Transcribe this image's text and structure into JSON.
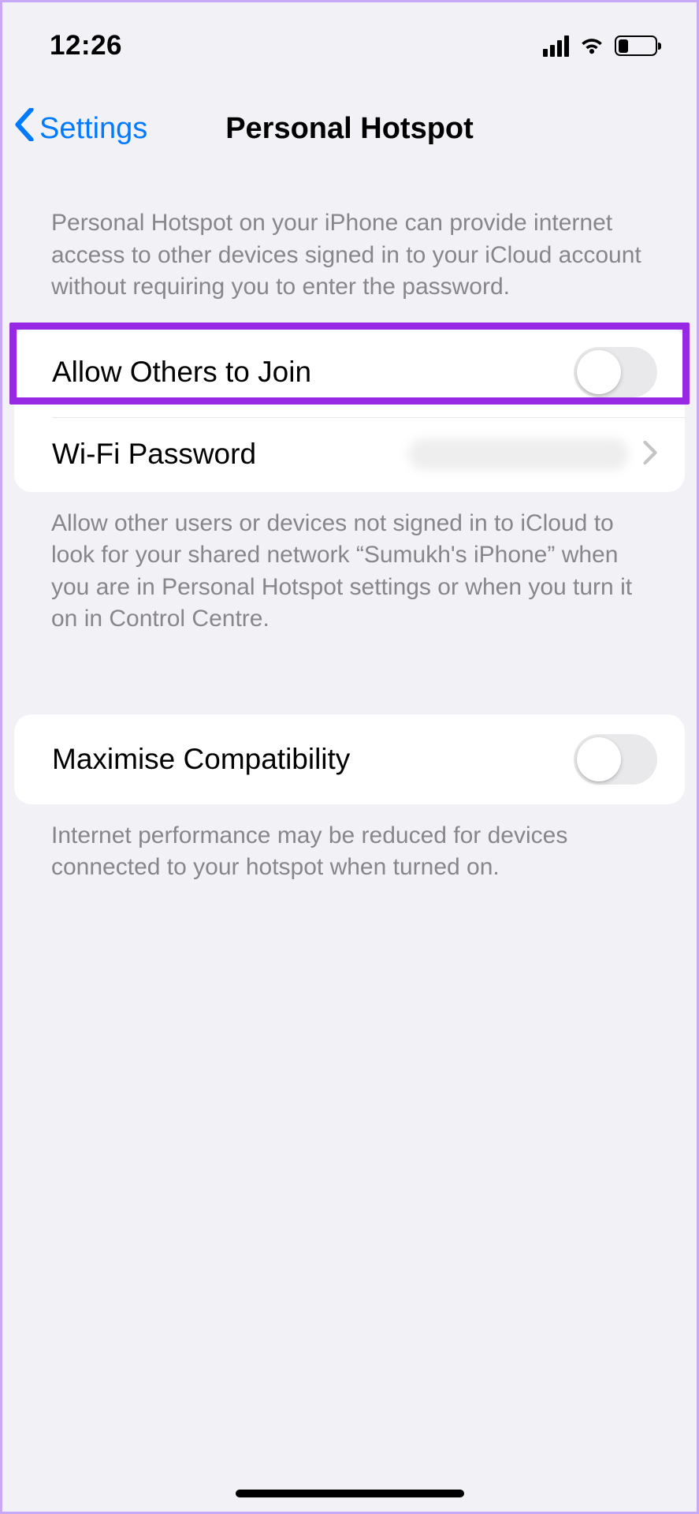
{
  "statusBar": {
    "time": "12:26"
  },
  "navBar": {
    "backLabel": "Settings",
    "title": "Personal Hotspot"
  },
  "section1": {
    "headerText": "Personal Hotspot on your iPhone can provide internet access to other devices signed in to your iCloud account without requiring you to enter the password.",
    "rows": {
      "allowOthers": {
        "label": "Allow Others to Join"
      },
      "wifiPassword": {
        "label": "Wi-Fi Password"
      }
    },
    "footerText": "Allow other users or devices not signed in to iCloud to look for your shared network “Sumukh's iPhone” when you are in Personal Hotspot settings or when you turn it on in Control Centre."
  },
  "section2": {
    "rows": {
      "maxCompat": {
        "label": "Maximise Compatibility"
      }
    },
    "footerText": "Internet performance may be reduced for devices connected to your hotspot when turned on."
  }
}
